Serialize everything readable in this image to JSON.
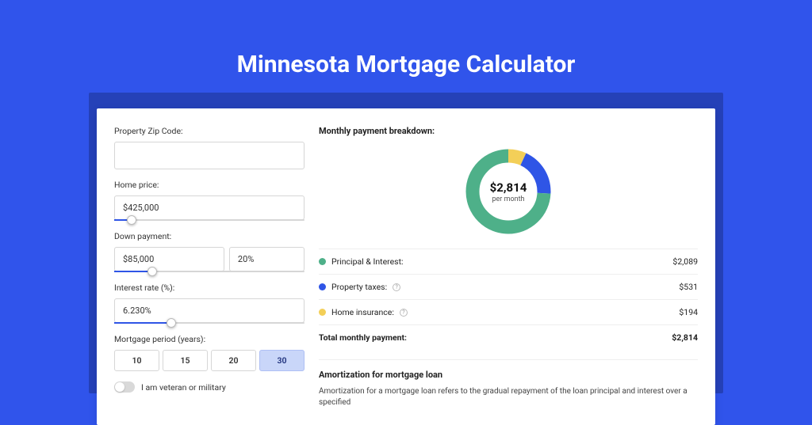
{
  "page": {
    "title": "Minnesota Mortgage Calculator"
  },
  "form": {
    "zip": {
      "label": "Property Zip Code:",
      "value": ""
    },
    "price": {
      "label": "Home price:",
      "value": "$425,000",
      "slider_pct": 9
    },
    "down": {
      "label": "Down payment:",
      "amount": "$85,000",
      "percent": "20%",
      "slider_pct": 20
    },
    "rate": {
      "label": "Interest rate (%):",
      "value": "6.230%",
      "slider_pct": 30
    },
    "period": {
      "label": "Mortgage period (years):",
      "options": [
        "10",
        "15",
        "20",
        "30"
      ],
      "active": "30"
    },
    "veteran": {
      "label": "I am veteran or military",
      "checked": false
    }
  },
  "breakdown": {
    "title": "Monthly payment breakdown:",
    "center_value": "$2,814",
    "center_label": "per month",
    "items": [
      {
        "label": "Principal & Interest:",
        "value": "$2,089",
        "color": "#4EB089",
        "has_help": false
      },
      {
        "label": "Property taxes:",
        "value": "$531",
        "color": "#2F55E6",
        "has_help": true
      },
      {
        "label": "Home insurance:",
        "value": "$194",
        "color": "#F3CF58",
        "has_help": true
      }
    ],
    "total_label": "Total monthly payment:",
    "total_value": "$2,814"
  },
  "amort": {
    "title": "Amortization for mortgage loan",
    "text": "Amortization for a mortgage loan refers to the gradual repayment of the loan principal and interest over a specified"
  },
  "chart_data": {
    "type": "pie",
    "title": "Monthly payment breakdown",
    "categories": [
      "Principal & Interest",
      "Property taxes",
      "Home insurance"
    ],
    "values": [
      2089,
      531,
      194
    ],
    "colors": [
      "#4EB089",
      "#2F55E6",
      "#F3CF58"
    ],
    "total": 2814,
    "center_label": "$2,814 per month"
  }
}
